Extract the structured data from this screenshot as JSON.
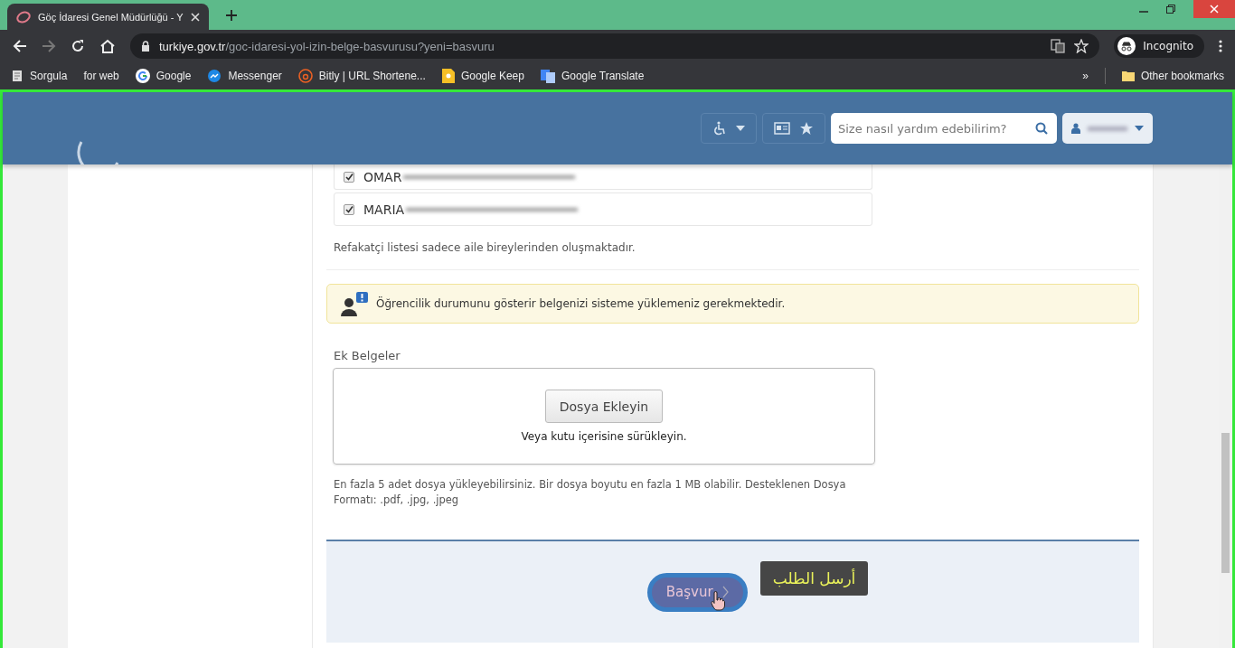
{
  "browser": {
    "tab_title": "Göç İdaresi Genel Müdürlüğü - Y",
    "url_host": "turkiye.gov.tr",
    "url_path": "/goc-idaresi-yol-izin-belge-basvurusu?yeni=basvuru",
    "profile": "Incognito",
    "bookmarks": [
      {
        "label": "Sorgula",
        "kind": "doc"
      },
      {
        "label": "for web",
        "kind": "none"
      },
      {
        "label": "Google",
        "kind": "google"
      },
      {
        "label": "Messenger",
        "kind": "messenger"
      },
      {
        "label": "Bitly | URL Shortene...",
        "kind": "bitly"
      },
      {
        "label": "Google Keep",
        "kind": "keep"
      },
      {
        "label": "Google Translate",
        "kind": "translate"
      }
    ],
    "more": "»",
    "other_bookmarks": "Other bookmarks"
  },
  "header": {
    "search_placeholder": "Size nasıl yardım edebilirim?"
  },
  "companions": [
    {
      "name": "OMAR",
      "checked": true
    },
    {
      "name": "MARIA",
      "checked": true
    }
  ],
  "companions_note": "Refakatçi listesi sadece aile bireylerinden oluşmaktadır.",
  "alert": "Öğrencilik durumunu gösterir belgenizi sisteme yüklemeniz gerekmektedir.",
  "attachments": {
    "label": "Ek Belgeler",
    "button": "Dosya Ekleyin",
    "drop_hint": "Veya kutu içerisine sürükleyin.",
    "help": "En fazla 5 adet dosya yükleyebilirsiniz. Bir dosya boyutu en fazla 1 MB olabilir. Desteklenen Dosya Formatı: .pdf, .jpg, .jpeg"
  },
  "submit": {
    "label": "Başvur",
    "tooltip": "أرسل الطلب"
  }
}
